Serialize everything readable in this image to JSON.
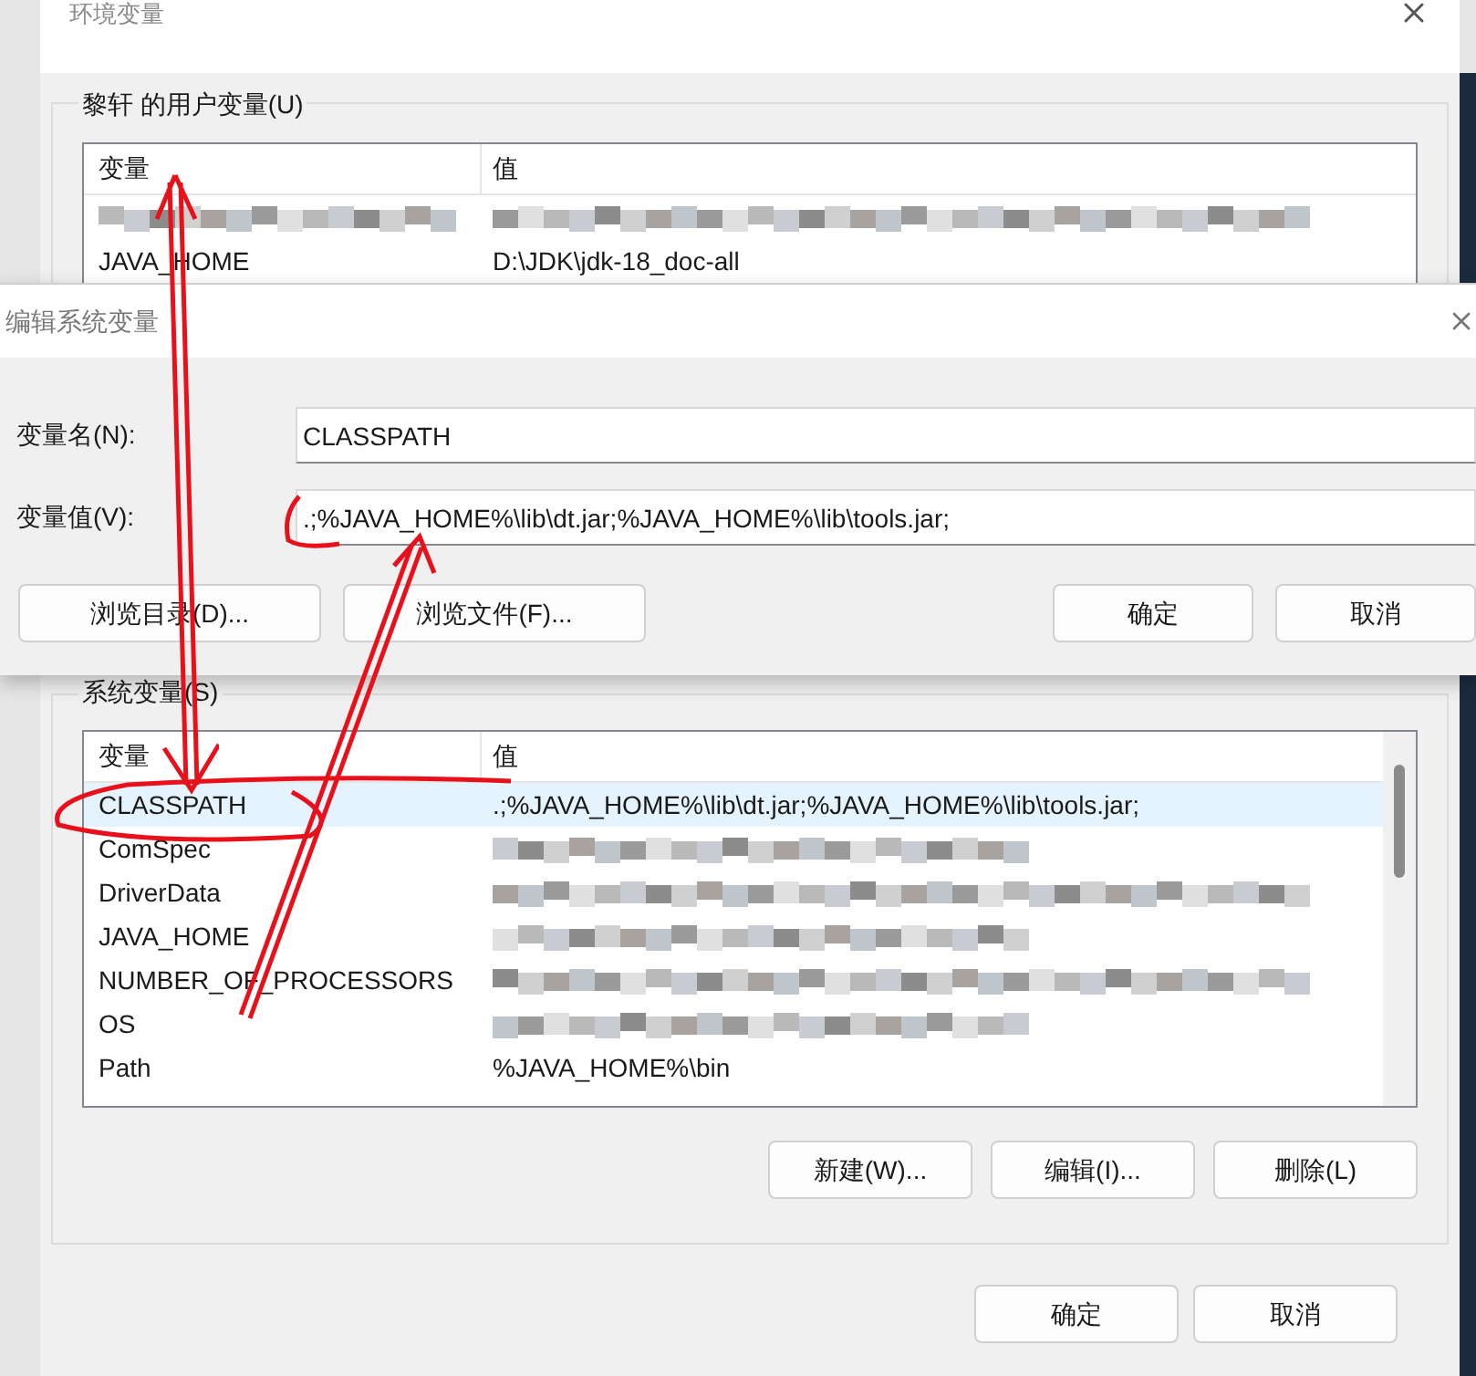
{
  "env_window": {
    "title": "环境变量",
    "user_vars": {
      "title": "黎轩 的用户变量(U)",
      "columns": [
        "变量",
        "值"
      ],
      "rows": [
        {
          "name_blurred": true,
          "value_blurred": true,
          "selected": false
        },
        {
          "name": "JAVA_HOME",
          "value": "D:\\JDK\\jdk-18_doc-all",
          "name_blurred": false,
          "value_blurred": false,
          "selected": false
        }
      ]
    },
    "system_vars": {
      "title": "系统变量(S)",
      "columns": [
        "变量",
        "值"
      ],
      "rows": [
        {
          "name": "CLASSPATH",
          "value": ".;%JAVA_HOME%\\lib\\dt.jar;%JAVA_HOME%\\lib\\tools.jar;",
          "name_blurred": false,
          "value_blurred": false,
          "selected": true
        },
        {
          "name": "ComSpec",
          "name_blurred": false,
          "value_blurred": true,
          "selected": false
        },
        {
          "name": "DriverData",
          "name_blurred": false,
          "value_blurred": true,
          "selected": false
        },
        {
          "name": "JAVA_HOME",
          "name_blurred": false,
          "value_blurred": true,
          "selected": false
        },
        {
          "name": "NUMBER_OF_PROCESSORS",
          "name_blurred": false,
          "value_blurred": true,
          "selected": false
        },
        {
          "name": "OS",
          "name_blurred": false,
          "value_blurred": true,
          "selected": false
        },
        {
          "name": "Path",
          "value": "%JAVA_HOME%\\bin",
          "name_blurred": false,
          "value_blurred": false,
          "selected": false
        }
      ]
    },
    "list_buttons": [
      "新建(W)...",
      "编辑(I)...",
      "删除(L)"
    ],
    "buttons": [
      "确定",
      "取消"
    ]
  },
  "edit_dialog": {
    "title": "编辑系统变量",
    "fields": [
      {
        "label": "变量名(N):",
        "value": "CLASSPATH"
      },
      {
        "label": "变量值(V):",
        "value": ".;%JAVA_HOME%\\lib\\dt.jar;%JAVA_HOME%\\lib\\tools.jar;"
      }
    ],
    "left_buttons": [
      "浏览目录(D)...",
      "浏览文件(F)..."
    ],
    "buttons": [
      "确定",
      "取消"
    ]
  }
}
